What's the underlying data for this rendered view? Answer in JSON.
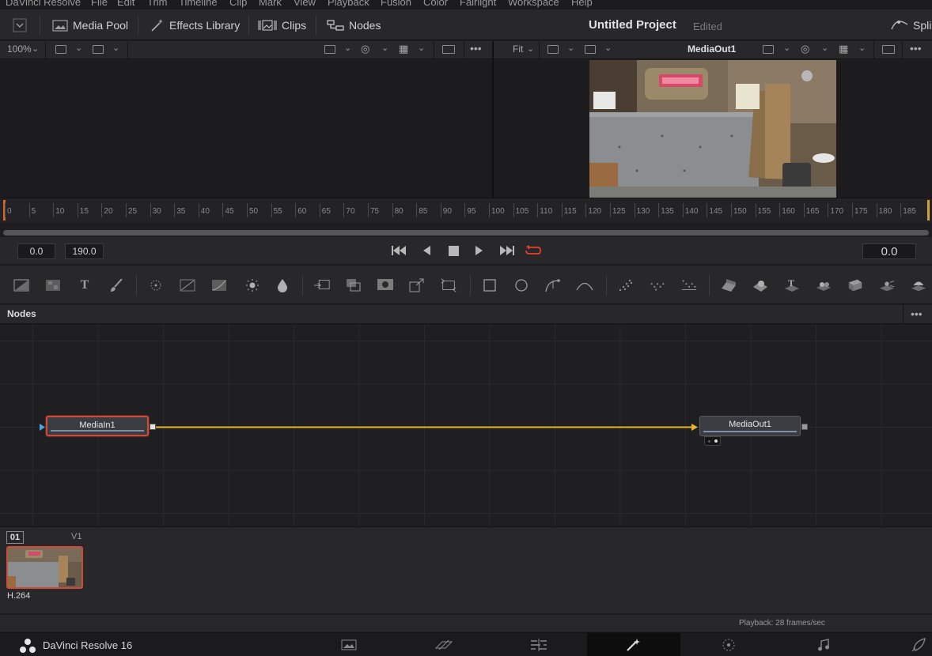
{
  "menubar": {
    "items": [
      "DaVinci Resolve",
      "File",
      "Edit",
      "Trim",
      "Timeline",
      "Clip",
      "Mark",
      "View",
      "Playback",
      "Fusion",
      "Color",
      "Fairlight",
      "Workspace",
      "Help"
    ]
  },
  "toolbar": {
    "media_pool": "Media Pool",
    "effects_library": "Effects Library",
    "clips": "Clips",
    "nodes": "Nodes",
    "spline": "Splin"
  },
  "project": {
    "title": "Untitled Project",
    "state": "Edited"
  },
  "viewer_left": {
    "zoom": "100%"
  },
  "viewer_right": {
    "zoom": "Fit",
    "name": "MediaOut1"
  },
  "ruler": {
    "ticks": [
      "0",
      "5",
      "10",
      "15",
      "20",
      "25",
      "30",
      "35",
      "40",
      "45",
      "50",
      "55",
      "60",
      "65",
      "70",
      "75",
      "80",
      "85",
      "90",
      "95",
      "100",
      "105",
      "110",
      "115",
      "120",
      "125",
      "130",
      "135",
      "140",
      "145",
      "150",
      "155",
      "160",
      "165",
      "170",
      "175",
      "180",
      "185"
    ]
  },
  "transport": {
    "start": "0.0",
    "end": "190.0",
    "current": "0.0"
  },
  "nodes": {
    "title": "Nodes",
    "media_in": "MediaIn1",
    "media_out": "MediaOut1",
    "link_color": "#e8b52a"
  },
  "clips": {
    "number": "01",
    "track": "V1",
    "codec": "H.264"
  },
  "status": {
    "text": "Playback: 28 frames/sec"
  },
  "pagebar": {
    "app_name": "DaVinci Resolve 16"
  },
  "colors": {
    "accent_red": "#d04a3c",
    "link_yellow": "#e8b52a",
    "panel": "#28282b"
  }
}
